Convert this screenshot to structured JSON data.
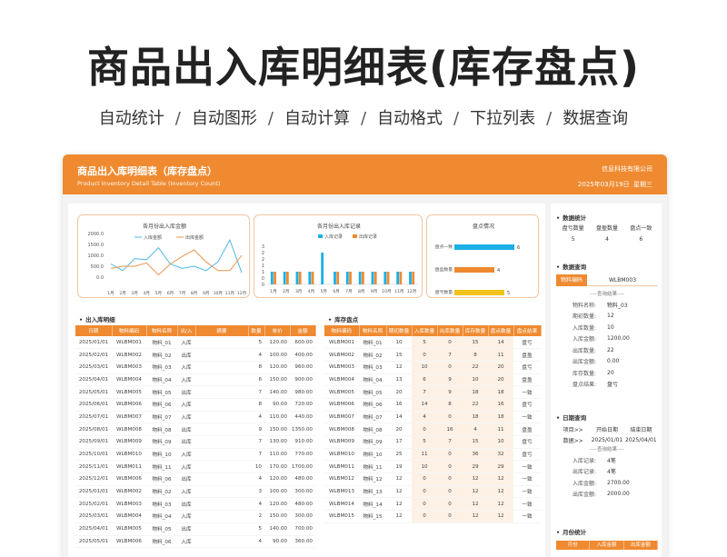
{
  "hero": {
    "title": "商品出入库明细表(库存盘点)",
    "features": [
      "自动统计",
      "自动图形",
      "自动计算",
      "自动格式",
      "下拉列表",
      "数据查询"
    ],
    "separator": "/"
  },
  "window": {
    "title": "商品出入库明细表（库存盘点）",
    "subtitle": "Product Inventory Detail Table (Inventory Count)",
    "company": "信息科技有限公司",
    "date": "2025年03月19日",
    "weekday": "星期三"
  },
  "colors": {
    "accent": "#ef8a30",
    "in_line": "#4fb8e8",
    "out_line": "#e8954f",
    "bar_blue": "#1ab0e6",
    "bar_orange": "#ef8a30",
    "bar_yellow": "#f2c21b"
  },
  "chart_data": [
    {
      "type": "line",
      "title": "各月份出入库金额",
      "categories": [
        "1月",
        "2月",
        "3月",
        "4月",
        "5月",
        "6月",
        "7月",
        "8月",
        "9月",
        "10月",
        "11月",
        "12月"
      ],
      "ylim": [
        0,
        2000
      ],
      "yticks": [
        "2000.0",
        "1500.0",
        "1000.0",
        "500.0",
        "0.0"
      ],
      "series": [
        {
          "name": "入库金额",
          "values": [
            600,
            300,
            850,
            800,
            1350,
            600,
            400,
            500,
            300,
            700,
            1700,
            200
          ]
        },
        {
          "name": "出库金额",
          "values": [
            400,
            500,
            500,
            650,
            100,
            600,
            950,
            1250,
            700,
            300,
            300,
            1000
          ]
        }
      ]
    },
    {
      "type": "bar",
      "title": "各月份出入库记录",
      "categories": [
        "1月",
        "2月",
        "3月",
        "4月",
        "5月",
        "6月",
        "7月",
        "8月",
        "9月",
        "10月",
        "11月",
        "12月"
      ],
      "ylim": [
        0,
        3
      ],
      "yticks": [
        "3",
        "2",
        "2",
        "1",
        "1",
        "0",
        "0"
      ],
      "series": [
        {
          "name": "入库记录",
          "values": [
            1,
            1,
            1,
            1,
            2.5,
            1,
            1,
            1,
            1,
            1,
            1,
            1
          ]
        },
        {
          "name": "出库记录",
          "values": [
            1,
            1,
            1,
            1,
            0,
            1,
            1,
            1,
            1,
            1,
            1,
            1
          ]
        }
      ]
    },
    {
      "type": "bar",
      "orientation": "horizontal",
      "title": "盘点情况",
      "categories": [
        "盘点一致",
        "盘盈数量",
        "盘亏数量"
      ],
      "values": [
        6,
        4,
        5
      ]
    }
  ],
  "in_out": {
    "title": "出入库明细",
    "headers": [
      "日期",
      "物料编码",
      "物料名称",
      "出/入",
      "摘要",
      "数量",
      "单价",
      "金额"
    ],
    "rows": [
      [
        "2025/01/01",
        "WLBM001",
        "物料_01",
        "入库",
        "",
        "5",
        "120.00",
        "600.00"
      ],
      [
        "2025/02/01",
        "WLBM002",
        "物料_02",
        "出库",
        "",
        "4",
        "100.00",
        "400.00"
      ],
      [
        "2025/03/01",
        "WLBM003",
        "物料_03",
        "入库",
        "",
        "8",
        "120.00",
        "960.00"
      ],
      [
        "2025/04/01",
        "WLBM004",
        "物料_04",
        "入库",
        "",
        "6",
        "150.00",
        "900.00"
      ],
      [
        "2025/05/01",
        "WLBM005",
        "物料_05",
        "出库",
        "",
        "7",
        "140.00",
        "980.00"
      ],
      [
        "2025/06/01",
        "WLBM006",
        "物料_06",
        "入库",
        "",
        "8",
        "90.00",
        "720.00"
      ],
      [
        "2025/07/01",
        "WLBM007",
        "物料_07",
        "入库",
        "",
        "4",
        "110.00",
        "440.00"
      ],
      [
        "2025/08/01",
        "WLBM008",
        "物料_08",
        "出库",
        "",
        "9",
        "150.00",
        "1350.00"
      ],
      [
        "2025/09/01",
        "WLBM009",
        "物料_09",
        "出库",
        "",
        "7",
        "130.00",
        "910.00"
      ],
      [
        "2025/10/01",
        "WLBM010",
        "物料_10",
        "入库",
        "",
        "7",
        "110.00",
        "770.00"
      ],
      [
        "2025/11/01",
        "WLBM011",
        "物料_11",
        "入库",
        "",
        "10",
        "170.00",
        "1700.00"
      ],
      [
        "2025/12/01",
        "WLBM006",
        "物料_06",
        "出库",
        "",
        "4",
        "120.00",
        "480.00"
      ],
      [
        "2025/01/01",
        "WLBM002",
        "物料_02",
        "入库",
        "",
        "3",
        "100.00",
        "300.00"
      ],
      [
        "2025/02/01",
        "WLBM003",
        "物料_03",
        "出库",
        "",
        "4",
        "120.00",
        "480.00"
      ],
      [
        "2025/03/01",
        "WLBM004",
        "物料_04",
        "入库",
        "",
        "2",
        "150.00",
        "300.00"
      ],
      [
        "2025/04/01",
        "WLBM005",
        "物料_05",
        "出库",
        "",
        "5",
        "140.00",
        "700.00"
      ],
      [
        "2025/05/01",
        "WLBM006",
        "物料_06",
        "入库",
        "",
        "4",
        "90.00",
        "360.00"
      ]
    ]
  },
  "inventory": {
    "title": "库存盘点",
    "headers": [
      "物料编码",
      "物料名称",
      "期初数量",
      "入库数量",
      "出库数量",
      "库存数量",
      "盘点数量",
      "盘点结果"
    ],
    "rows": [
      [
        "WLBM001",
        "物料_01",
        "10",
        "5",
        "0",
        "15",
        "14",
        "盘亏"
      ],
      [
        "WLBM002",
        "物料_02",
        "15",
        "0",
        "7",
        "8",
        "11",
        "盘盈"
      ],
      [
        "WLBM003",
        "物料_03",
        "12",
        "10",
        "0",
        "22",
        "20",
        "盘亏"
      ],
      [
        "WLBM004",
        "物料_04",
        "13",
        "6",
        "9",
        "10",
        "20",
        "盘盈"
      ],
      [
        "WLBM005",
        "物料_05",
        "20",
        "7",
        "9",
        "18",
        "18",
        "一致"
      ],
      [
        "WLBM006",
        "物料_06",
        "16",
        "14",
        "8",
        "22",
        "16",
        "盘亏"
      ],
      [
        "WLBM007",
        "物料_07",
        "14",
        "4",
        "0",
        "18",
        "18",
        "一致"
      ],
      [
        "WLBM008",
        "物料_08",
        "20",
        "0",
        "16",
        "4",
        "11",
        "盘盈"
      ],
      [
        "WLBM009",
        "物料_09",
        "17",
        "5",
        "7",
        "15",
        "10",
        "盘亏"
      ],
      [
        "WLBM010",
        "物料_10",
        "25",
        "11",
        "0",
        "36",
        "32",
        "盘亏"
      ],
      [
        "WLBM011",
        "物料_11",
        "19",
        "10",
        "0",
        "29",
        "29",
        "一致"
      ],
      [
        "WLBM012",
        "物料_12",
        "12",
        "0",
        "0",
        "12",
        "12",
        "一致"
      ],
      [
        "WLBM013",
        "物料_13",
        "12",
        "0",
        "0",
        "12",
        "12",
        "一致"
      ],
      [
        "WLBM014",
        "物料_14",
        "12",
        "0",
        "0",
        "12",
        "12",
        "一致"
      ],
      [
        "WLBM015",
        "物料_15",
        "12",
        "0",
        "0",
        "12",
        "12",
        "一致"
      ]
    ]
  },
  "side": {
    "stats": {
      "title": "数据统计",
      "labels": [
        "盘亏数量",
        "盘盈数量",
        "盘点一致"
      ],
      "values": [
        "5",
        "4",
        "6"
      ]
    },
    "query": {
      "title": "数据查询",
      "label": "物料编码",
      "value": "WLBM003",
      "divider": "----查询结果----",
      "rows": [
        {
          "k": "物料名称:",
          "v": "物料_03"
        },
        {
          "k": "期初数量:",
          "v": "12"
        },
        {
          "k": "入库数量:",
          "v": "10"
        },
        {
          "k": "入库金额:",
          "v": "1200.00"
        },
        {
          "k": "出库数量:",
          "v": "22"
        },
        {
          "k": "出库金额:",
          "v": "0.00"
        },
        {
          "k": "库存数量:",
          "v": "20"
        },
        {
          "k": "盘点结果:",
          "v": "盘亏"
        }
      ]
    },
    "date_query": {
      "title": "日期查询",
      "head": [
        "项目>>",
        "开始日期",
        "结束日期"
      ],
      "values": [
        "数据>>",
        "2025/01/01",
        "2025/04/01"
      ],
      "divider": "----查询结果----",
      "rows": [
        {
          "k": "入库记录:",
          "v": "4笔"
        },
        {
          "k": "出库记录:",
          "v": "4笔"
        },
        {
          "k": "入库金额:",
          "v": "2700.00"
        },
        {
          "k": "出库金额:",
          "v": "2000.00"
        }
      ]
    },
    "monthly": {
      "title": "月份统计",
      "headers": [
        "月份",
        "入库金额",
        "出库金额"
      ]
    }
  }
}
